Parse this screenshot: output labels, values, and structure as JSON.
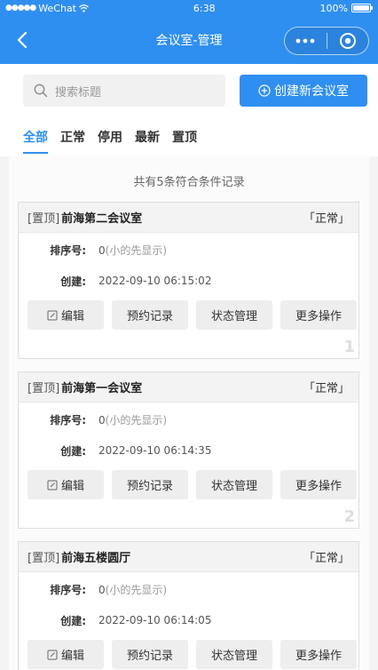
{
  "status_bar": {
    "carrier": "WeChat",
    "time": "6:38",
    "battery": "100%"
  },
  "nav": {
    "title": "会议室-管理"
  },
  "search": {
    "placeholder": "搜索标题"
  },
  "create_button": {
    "label": "创建新会议室"
  },
  "tabs": [
    {
      "label": "全部",
      "active": true
    },
    {
      "label": "正常",
      "active": false
    },
    {
      "label": "停用",
      "active": false
    },
    {
      "label": "最新",
      "active": false
    },
    {
      "label": "置顶",
      "active": false
    }
  ],
  "summary": "共有5条符合条件记录",
  "cards": [
    {
      "pin_tag": "[置顶]",
      "name": "前海第二会议室",
      "status": "「正常」",
      "order_label": "排序号:",
      "order_value": "0",
      "order_hint": "(小的先显示)",
      "created_label": "创建:",
      "created_value": "2022-09-10 06:15:02",
      "index": "1"
    },
    {
      "pin_tag": "[置顶]",
      "name": "前海第一会议室",
      "status": "「正常」",
      "order_label": "排序号:",
      "order_value": "0",
      "order_hint": "(小的先显示)",
      "created_label": "创建:",
      "created_value": "2022-09-10 06:14:35",
      "index": "2"
    },
    {
      "pin_tag": "[置顶]",
      "name": "前海五楼圆厅",
      "status": "「正常」",
      "order_label": "排序号:",
      "order_value": "0",
      "order_hint": "(小的先显示)",
      "created_label": "创建:",
      "created_value": "2022-09-10 06:14:05",
      "index": "3"
    }
  ],
  "card_actions": {
    "edit": "编辑",
    "bookings": "预约记录",
    "status": "状态管理",
    "more": "更多操作"
  },
  "colors": {
    "primary": "#2f8ff0",
    "background": "#f4f4f4"
  }
}
